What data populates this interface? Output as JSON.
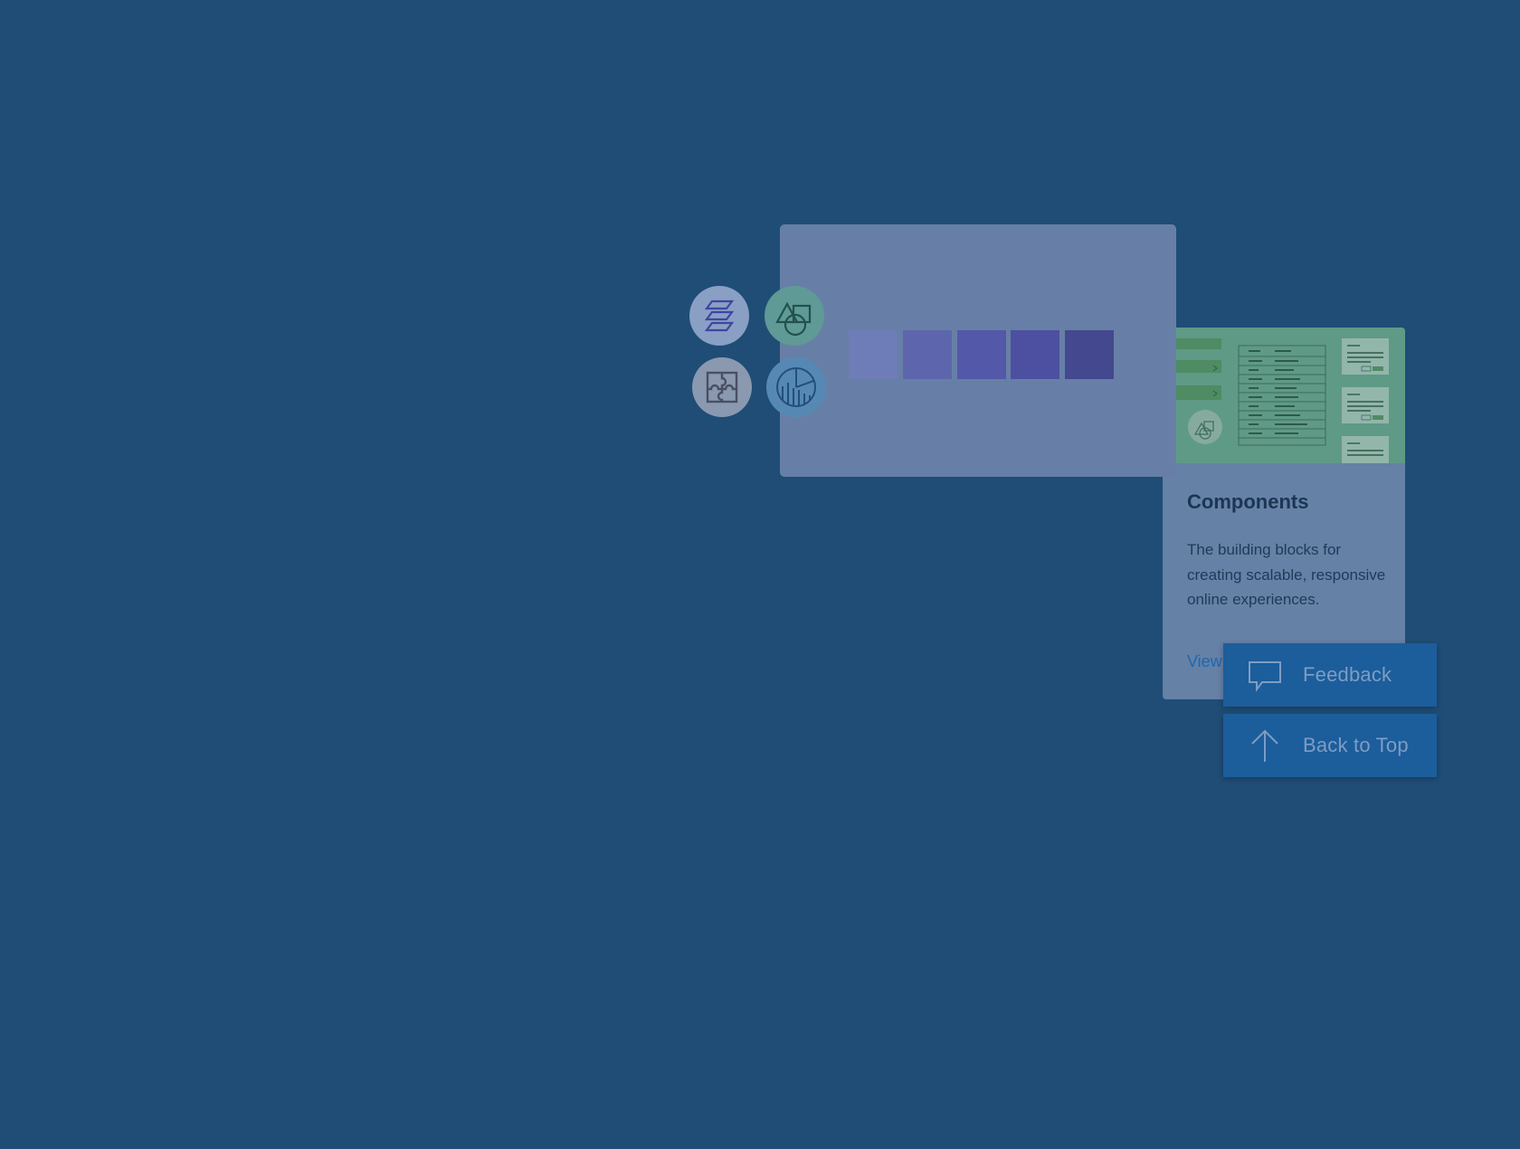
{
  "components_card": {
    "title": "Components",
    "description": "The building blocks for creating scalable, responsive online experiences.",
    "link_label": "View"
  },
  "color_palette": {
    "swatches": [
      "#6e7cb7",
      "#5d66ac",
      "#5458a8",
      "#4d50a0",
      "#44488f"
    ]
  },
  "icons": [
    "layers-icon",
    "shapes-icon",
    "puzzle-icon",
    "chart-icon"
  ],
  "buttons": {
    "feedback_label": "Feedback",
    "back_to_top_label": "Back to Top"
  },
  "colors": {
    "background": "#1f4d76",
    "card": "#677fa6",
    "button": "#1c5d9b",
    "thumbnail_green": "#5f9a86"
  }
}
